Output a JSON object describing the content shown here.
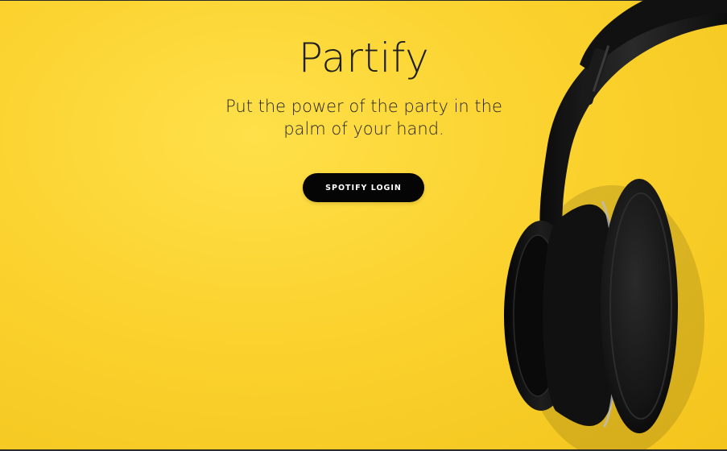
{
  "hero": {
    "title": "Partify",
    "tagline": "Put the power of the party in the palm of your hand.",
    "login_button": "SPOTIFY LOGIN"
  },
  "image": {
    "subject": "headphones",
    "background_color": "#fbd22e",
    "headphone_color": "#111111"
  }
}
